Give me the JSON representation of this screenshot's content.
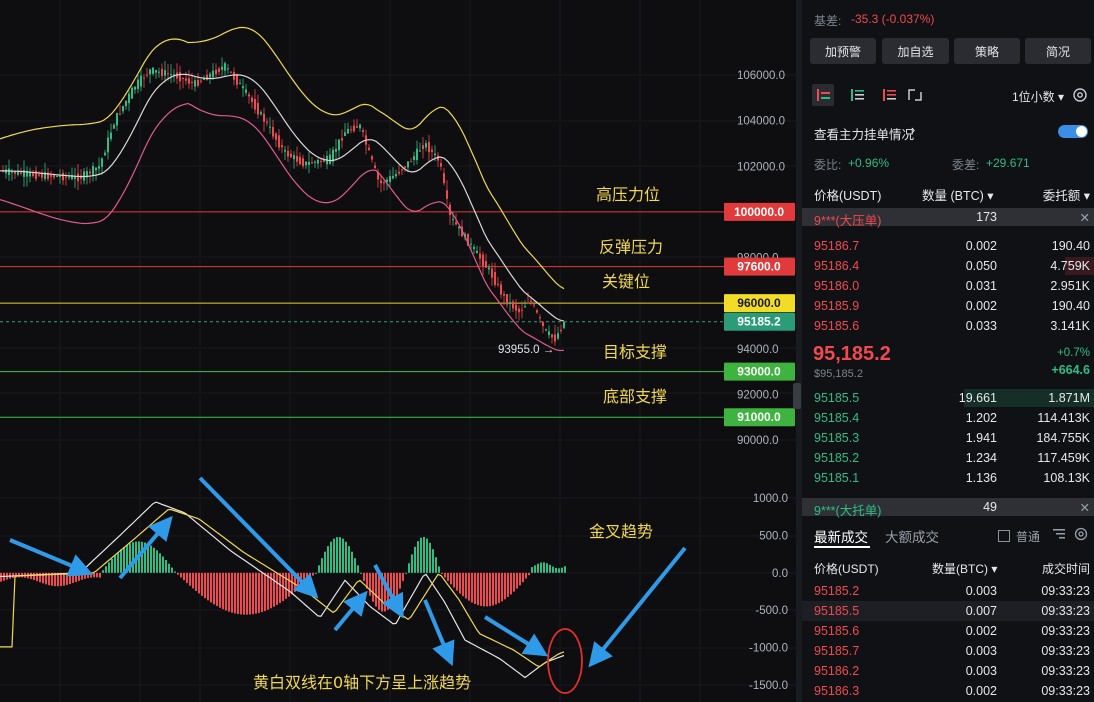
{
  "chart": {
    "price_labels": [
      {
        "text": "106000.0",
        "v": 106000
      },
      {
        "text": "104000.0",
        "v": 104000
      },
      {
        "text": "102000.0",
        "v": 102000
      },
      {
        "text": "98000.0",
        "v": 98000
      },
      {
        "text": "94000.0",
        "v": 94000
      },
      {
        "text": "92000.0",
        "v": 92000
      },
      {
        "text": "90000.0",
        "v": 90000
      }
    ],
    "macd_labels": [
      "1000.0",
      "500.0",
      "0.0",
      "-500.0",
      "-1000.0",
      "-1500.0"
    ],
    "levels": [
      {
        "name": "高压力位",
        "value": 100000,
        "tag": "100000.0",
        "color": "#e03a3a",
        "tag_color": "#e03a3a"
      },
      {
        "name": "反弹压力",
        "value": 97600,
        "tag": "97600.0",
        "color": "#e03a3a",
        "tag_color": "#e03a3a"
      },
      {
        "name": "关键位",
        "value": 96000,
        "tag": "96000.0",
        "color": "#e8d233",
        "tag_color": "#f1dc26"
      },
      {
        "name": "目标支撑",
        "value": 93000,
        "tag": "93000.0",
        "color": "#3fc43f",
        "tag_color": "#3fb33f"
      },
      {
        "name": "底部支撑",
        "value": 91000,
        "tag": "91000.0",
        "color": "#3fc43f",
        "tag_color": "#3fb33f"
      }
    ],
    "current_price_tag": "95185.2",
    "current_price": 95185.2,
    "low_marker": "93955.0",
    "annotations": {
      "golden_cross": "金叉趋势",
      "bottom_note": "黄白双线在0轴下方呈上涨趋势"
    },
    "colors": {
      "up": "#2ebd85",
      "down": "#f0494f",
      "boll_upper": "#f1d84e",
      "boll_mid": "#d8d8d8",
      "boll_lower": "#e05a8c",
      "arrow": "#2f9be8"
    }
  },
  "panel": {
    "basis_label": "基差:",
    "basis_value": "-35.3 (-0.037%)",
    "buttons": [
      "加预警",
      "加自选",
      "策略",
      "简况"
    ],
    "decimal_select": "1位小数",
    "main_orders_link": "查看主力挂单情况",
    "ratio_label": "委比:",
    "ratio_value": "+0.96%",
    "diff_label": "委差:",
    "diff_value": "+29.671",
    "orderbook_headers": [
      "价格(USDT)",
      "数量 (BTC)",
      "委托额"
    ],
    "big_ask": {
      "label": "9***(大压单)",
      "qty": "173"
    },
    "asks": [
      {
        "price": "95186.7",
        "qty": "0.002",
        "total": "190.40",
        "depth": 0.0
      },
      {
        "price": "95186.4",
        "qty": "0.050",
        "total": "4.759K",
        "depth": 0.22
      },
      {
        "price": "95186.0",
        "qty": "0.031",
        "total": "2.951K",
        "depth": 0.0
      },
      {
        "price": "95185.9",
        "qty": "0.002",
        "total": "190.40",
        "depth": 0.0
      },
      {
        "price": "95185.6",
        "qty": "0.033",
        "total": "3.141K",
        "depth": 0.0
      }
    ],
    "last_price": "95,185.2",
    "last_price_sub": "$95,185.2",
    "change_pct": "+0.7%",
    "change_abs": "+664.6",
    "bids": [
      {
        "price": "95185.5",
        "qty": "19.661",
        "total": "1.871M",
        "depth": 1.0
      },
      {
        "price": "95185.4",
        "qty": "1.202",
        "total": "114.413K",
        "depth": 0.0
      },
      {
        "price": "95185.3",
        "qty": "1.941",
        "total": "184.755K",
        "depth": 0.0
      },
      {
        "price": "95185.2",
        "qty": "1.234",
        "total": "117.459K",
        "depth": 0.0
      },
      {
        "price": "95185.1",
        "qty": "1.136",
        "total": "108.13K",
        "depth": 0.0
      }
    ],
    "big_bid": {
      "label": "9***(大托单)",
      "qty": "49"
    },
    "tabs": [
      "最新成交",
      "大额成交"
    ],
    "normal_label": "普通",
    "trade_headers": [
      "价格(USDT)",
      "数量(BTC)",
      "成交时间"
    ],
    "trades": [
      {
        "price": "95185.2",
        "qty": "0.003",
        "time": "09:33:23",
        "side": "sell"
      },
      {
        "price": "95185.5",
        "qty": "0.007",
        "time": "09:33:23",
        "side": "sell"
      },
      {
        "price": "95185.6",
        "qty": "0.002",
        "time": "09:33:23",
        "side": "sell"
      },
      {
        "price": "95185.7",
        "qty": "0.003",
        "time": "09:33:23",
        "side": "sell"
      },
      {
        "price": "95186.2",
        "qty": "0.003",
        "time": "09:33:23",
        "side": "sell"
      },
      {
        "price": "95186.3",
        "qty": "0.002",
        "time": "09:33:23",
        "side": "sell"
      }
    ]
  }
}
